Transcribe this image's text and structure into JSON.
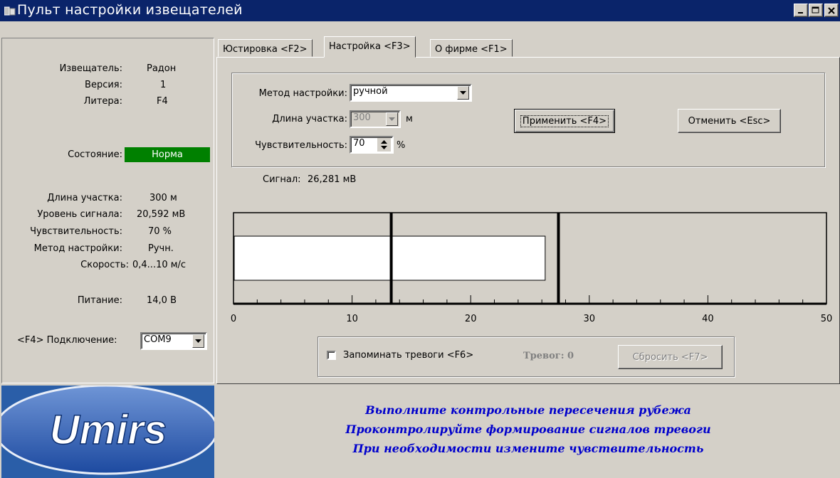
{
  "window": {
    "title": "Пульт настройки извещателей"
  },
  "left": {
    "device_label": "Извещатель:",
    "device_value": "Радон",
    "version_label": "Версия:",
    "version_value": "1",
    "litera_label": "Литера:",
    "litera_value": "F4",
    "state_label": "Состояние:",
    "state_value": "Норма",
    "section_label": "Длина участка:",
    "section_value": "300  м",
    "signal_label": "Уровень сигнала:",
    "signal_value": "20,592  мВ",
    "sens_label": "Чувствительность:",
    "sens_value": "70  %",
    "method_label": "Метод настройки:",
    "method_value": "Ручн.",
    "speed_label": "Скорость:",
    "speed_value": "0,4...10  м/с",
    "power_label": "Питание:",
    "power_value": "14,0  В",
    "connect_label": "<F4> Подключение:",
    "connect_value": "COM9"
  },
  "logo": {
    "text": "Umirs"
  },
  "tabs": [
    {
      "label": "Юстировка <F2>"
    },
    {
      "label": "Настройка <F3>"
    },
    {
      "label": "О фирме <F1>"
    }
  ],
  "settings": {
    "method_label": "Метод настройки:",
    "method_value": "ручной",
    "length_label": "Длина участка:",
    "length_value": "300",
    "length_unit": "м",
    "sens_label": "Чувствительность:",
    "sens_value": "70",
    "sens_unit": "%",
    "apply_button": "Применить <F4>",
    "cancel_button": "Отменить <Esc>"
  },
  "signal": {
    "label": "Сигнал:",
    "value": "26,281  мВ"
  },
  "chart_data": {
    "type": "bar",
    "orientation": "horizontal",
    "values": [
      26.281
    ],
    "xlim": [
      0,
      50
    ],
    "ticks": [
      "0",
      "10",
      "20",
      "30",
      "40",
      "50"
    ],
    "markers": [
      13.3,
      27.4
    ]
  },
  "alarms": {
    "remember_label": "Запоминать тревоги <F6>",
    "remember_checked": false,
    "count_text": "Тревог: 0",
    "reset_button": "Сбросить <F7>"
  },
  "instructions": [
    "Выполните контрольные пересечения рубежа",
    "Проконтролируйте формирование сигналов тревоги",
    "При необходимости измените чувствительность"
  ]
}
